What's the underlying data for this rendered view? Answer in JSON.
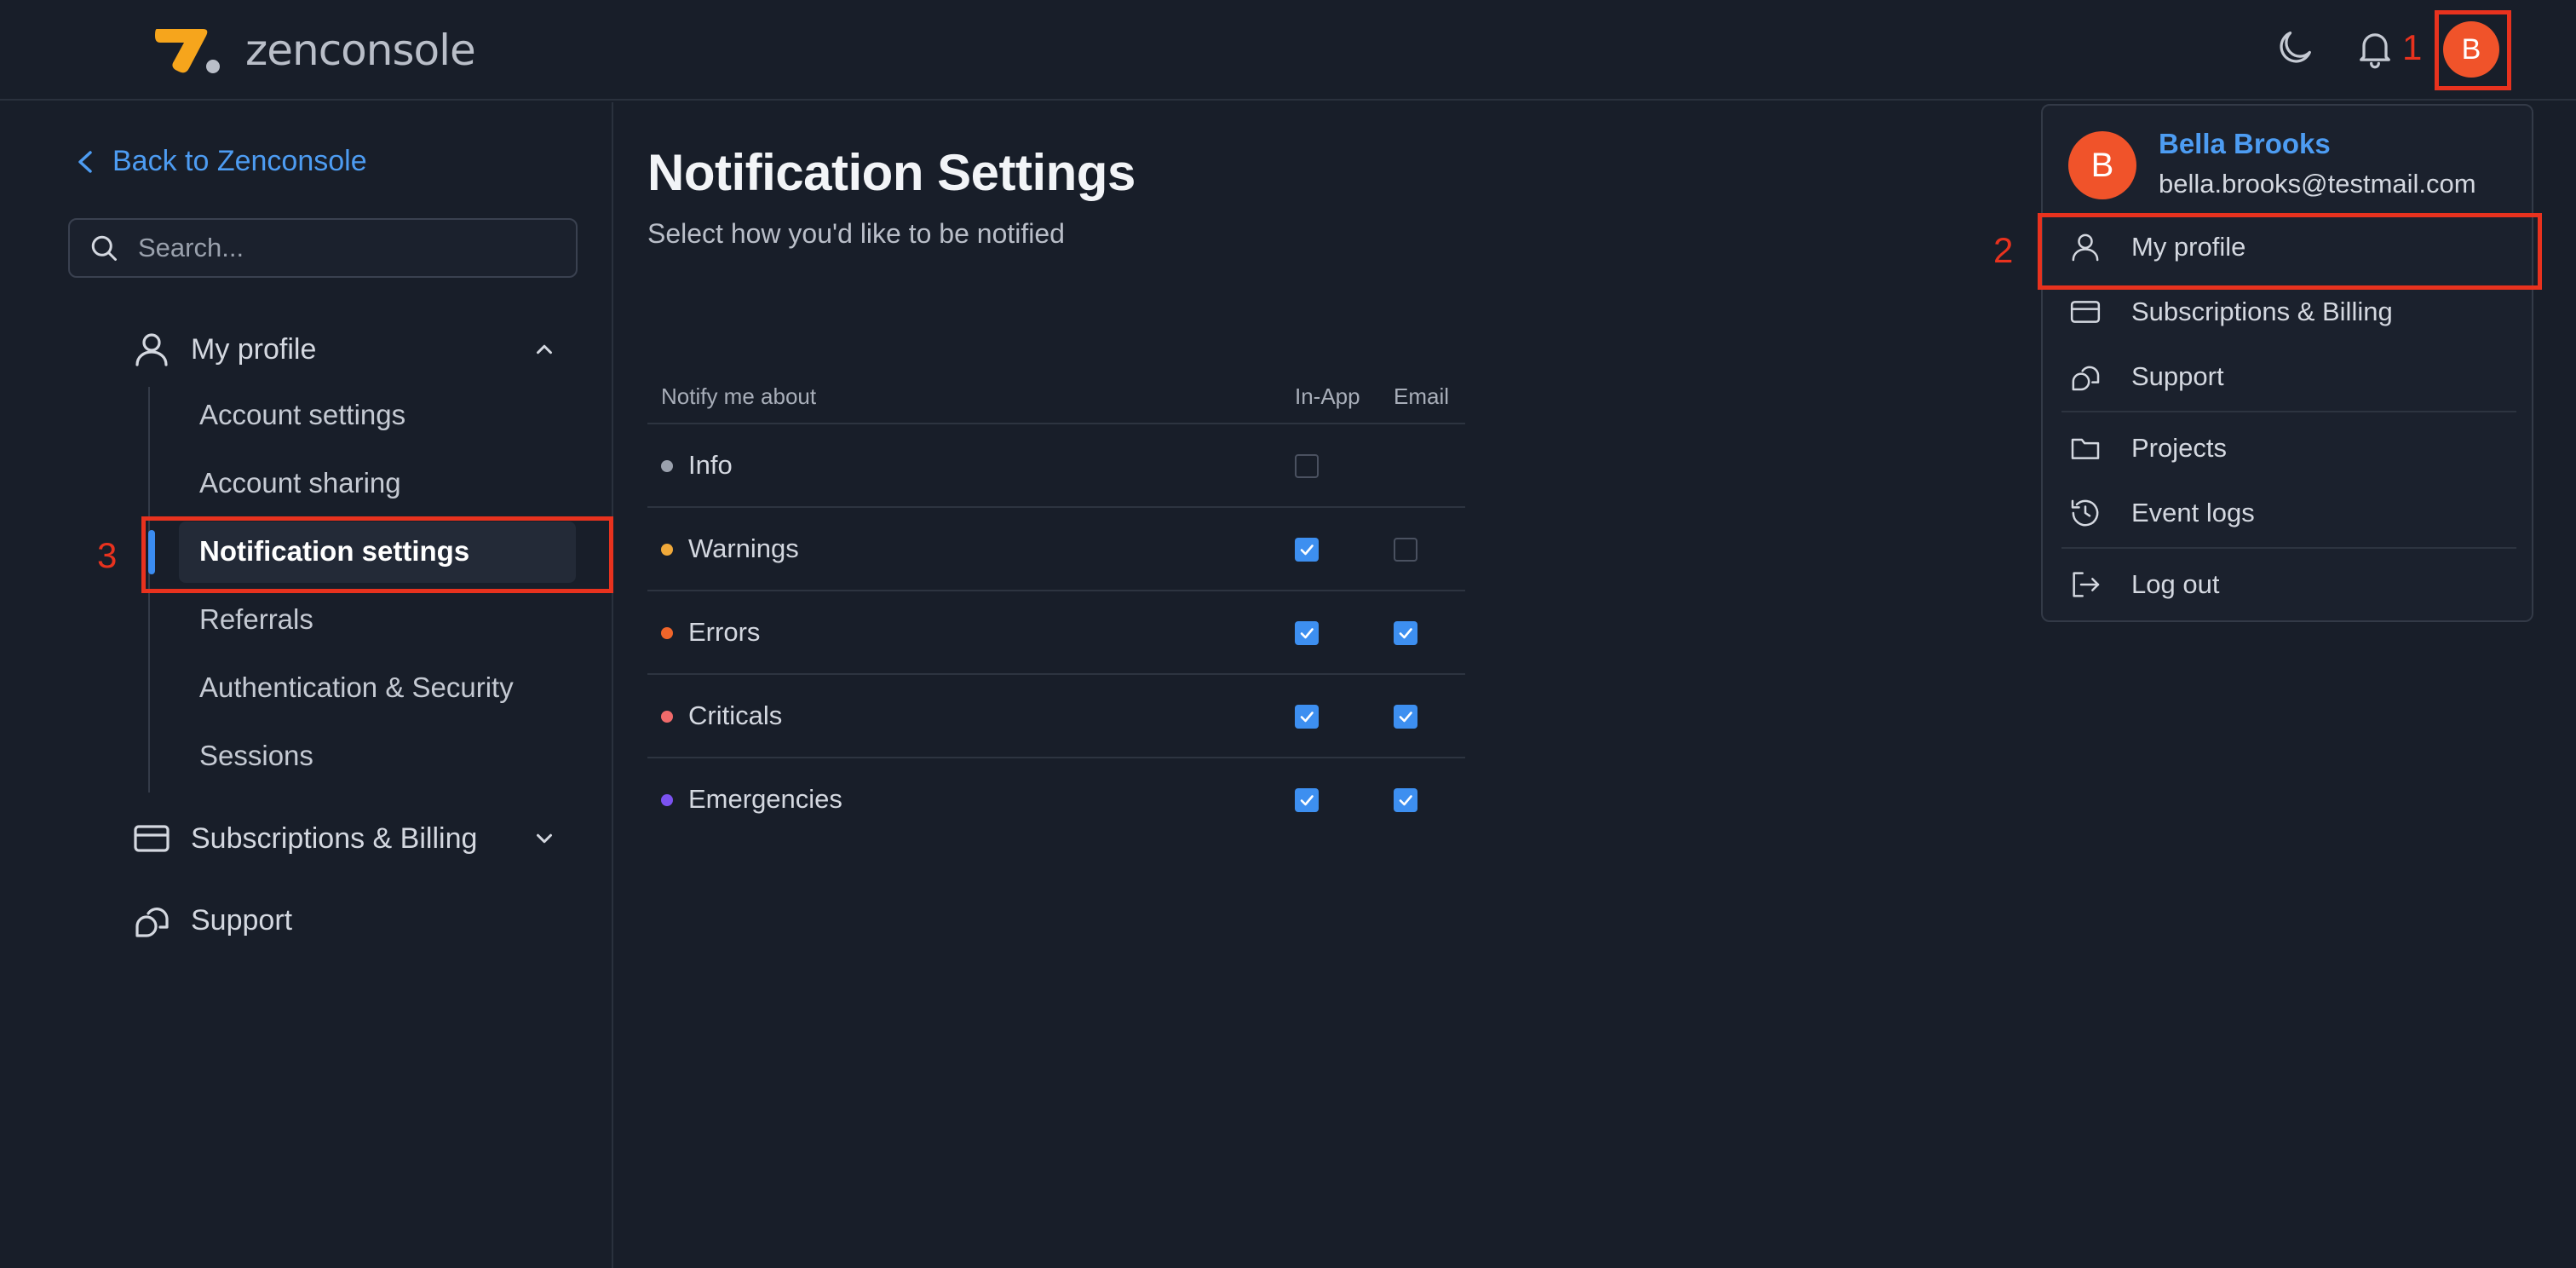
{
  "header": {
    "logo_text": "zenconsole",
    "user_initial": "B"
  },
  "annotations": {
    "one": "1",
    "two": "2",
    "three": "3"
  },
  "sidebar": {
    "back_label": "Back to Zenconsole",
    "search_placeholder": "Search...",
    "groups": [
      {
        "label": "My profile",
        "items": [
          "Account settings",
          "Account sharing",
          "Notification settings",
          "Referrals",
          "Authentication & Security",
          "Sessions"
        ],
        "active": "Notification settings"
      },
      {
        "label": "Subscriptions & Billing"
      },
      {
        "label": "Support"
      }
    ]
  },
  "main": {
    "title": "Notification Settings",
    "subtitle": "Select how you'd like to be notified",
    "table": {
      "headers": {
        "notify": "Notify me about",
        "inapp": "In-App",
        "email": "Email"
      },
      "rows": [
        {
          "label": "Info",
          "color": "#9aa1ad",
          "inapp": false,
          "email": null
        },
        {
          "label": "Warnings",
          "color": "#f0a93a",
          "inapp": true,
          "email": false
        },
        {
          "label": "Errors",
          "color": "#f0652a",
          "inapp": true,
          "email": true
        },
        {
          "label": "Criticals",
          "color": "#f06a6a",
          "inapp": true,
          "email": true
        },
        {
          "label": "Emergencies",
          "color": "#7b52f0",
          "inapp": true,
          "email": true
        }
      ]
    }
  },
  "dropdown": {
    "user_initial": "B",
    "name": "Bella Brooks",
    "email": "bella.brooks@testmail.com",
    "items": [
      "My profile",
      "Subscriptions & Billing",
      "Support",
      "Projects",
      "Event logs",
      "Log out"
    ]
  },
  "colors": {
    "accent": "#3d8ff0",
    "brand": "#f0532a",
    "annotation": "#e8321e"
  }
}
